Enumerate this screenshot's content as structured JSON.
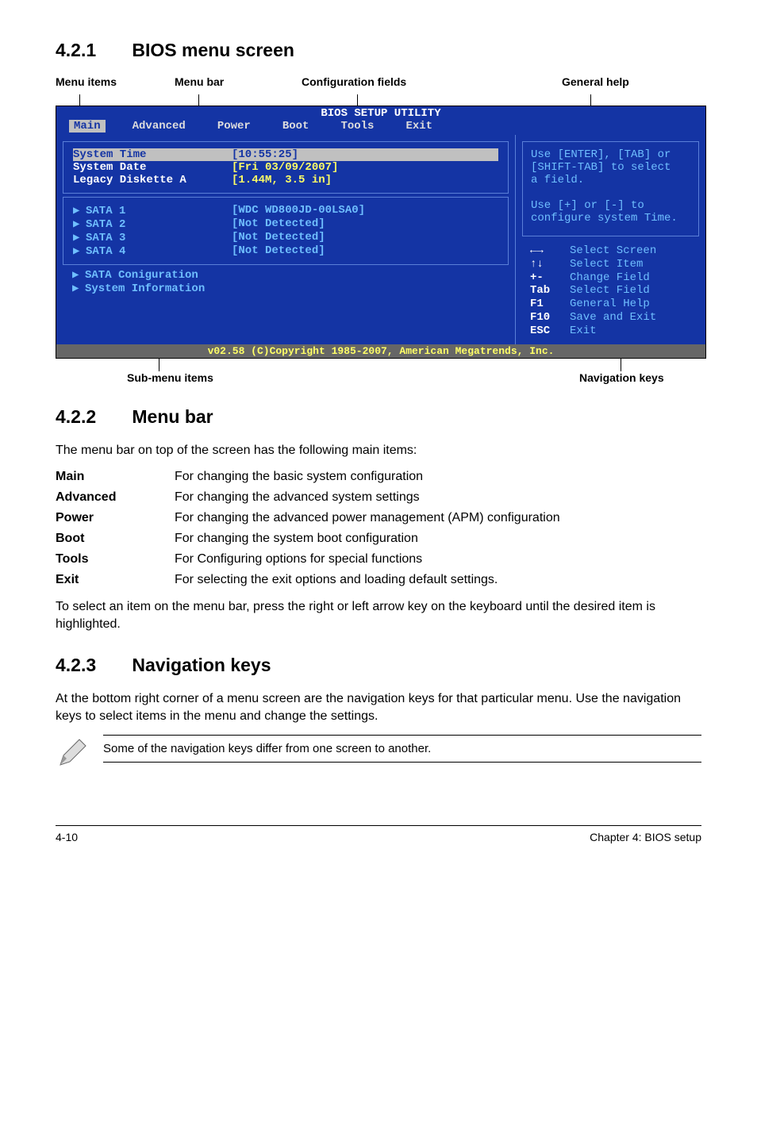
{
  "sections": {
    "s421": {
      "num": "4.2.1",
      "title": "BIOS menu screen"
    },
    "s422": {
      "num": "4.2.2",
      "title": "Menu bar"
    },
    "s423": {
      "num": "4.2.3",
      "title": "Navigation keys"
    }
  },
  "labels": {
    "menu_items": "Menu items",
    "menu_bar": "Menu bar",
    "config_fields": "Configuration fields",
    "general_help": "General help",
    "sub_menu": "Sub-menu items",
    "nav_keys": "Navigation keys"
  },
  "bios": {
    "title": "BIOS SETUP UTILITY",
    "menu": [
      "Main",
      "Advanced",
      "Power",
      "Boot",
      "Tools",
      "Exit"
    ],
    "rows": [
      {
        "label": "System Time",
        "value": "[10:55:25]",
        "hl": true
      },
      {
        "label": "System Date",
        "value": "[Fri 03/09/2007]"
      },
      {
        "label": "Legacy Diskette A",
        "value": "[1.44M, 3.5 in]"
      }
    ],
    "sata": [
      {
        "label": "SATA 1",
        "value": "[WDC WD800JD-00LSA0]"
      },
      {
        "label": "SATA 2",
        "value": "[Not Detected]"
      },
      {
        "label": "SATA 3",
        "value": "[Not Detected]"
      },
      {
        "label": "SATA 4",
        "value": "[Not Detected]"
      }
    ],
    "bottom": [
      {
        "label": "SATA Coniguration"
      },
      {
        "label": "System Information"
      }
    ],
    "help_lines": [
      "Use [ENTER], [TAB] or",
      "[SHIFT-TAB] to select",
      "a field.",
      "",
      "Use [+] or [-] to",
      "configure system Time."
    ],
    "nav": [
      {
        "key": "←→",
        "desc": "Select Screen"
      },
      {
        "key": "↑↓",
        "desc": "Select Item"
      },
      {
        "key": "+-",
        "desc": "Change Field"
      },
      {
        "key": "Tab",
        "desc": "Select Field"
      },
      {
        "key": "F1",
        "desc": "General Help"
      },
      {
        "key": "F10",
        "desc": "Save and Exit"
      },
      {
        "key": "ESC",
        "desc": "Exit"
      }
    ],
    "copyright": "v02.58 (C)Copyright 1985-2007, American Megatrends, Inc."
  },
  "menubar_intro": "The menu bar on top of the screen has the following main items:",
  "menubar_items": [
    {
      "k": "Main",
      "v": "For changing the basic system configuration"
    },
    {
      "k": "Advanced",
      "v": "For changing the advanced system settings"
    },
    {
      "k": "Power",
      "v": "For changing the advanced power management (APM) configuration"
    },
    {
      "k": "Boot",
      "v": "For changing the system boot configuration"
    },
    {
      "k": "Tools",
      "v": "For Configuring options for special functions"
    },
    {
      "k": "Exit",
      "v": "For selecting the exit options and loading default settings."
    }
  ],
  "menubar_outro": "To select an item on the menu bar, press the right or left arrow key on the keyboard until the desired item is highlighted.",
  "navkeys_text": "At the bottom right corner of a menu screen are the navigation keys for that particular menu. Use the navigation keys to select items in the menu and change the settings.",
  "note": "Some of the navigation keys differ from one screen to another.",
  "footer": {
    "left": "4-10",
    "right": "Chapter 4: BIOS setup"
  }
}
